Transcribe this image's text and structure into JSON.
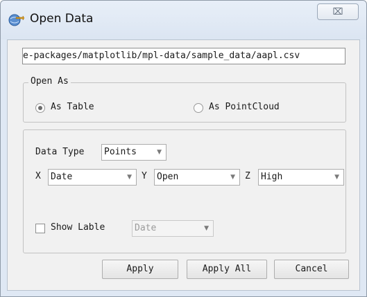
{
  "window": {
    "title": "Open Data",
    "close_glyph": "⌧"
  },
  "path": {
    "value": "site-packages/matplotlib/mpl-data/sample_data/aapl.csv",
    "visible": "e-packages/matplotlib/mpl-data/sample_data/aapl.csv"
  },
  "open_as": {
    "legend": "Open As",
    "options": [
      {
        "label": "As Table",
        "checked": true
      },
      {
        "label": "As PointCloud",
        "checked": false
      }
    ]
  },
  "data_settings": {
    "data_type_label": "Data Type",
    "data_type_value": "Points",
    "x_label": "X",
    "x_value": "Date",
    "y_label": "Y",
    "y_value": "Open",
    "z_label": "Z",
    "z_value": "High",
    "show_label_text": "Show Lable",
    "show_label_checked": false,
    "show_label_value": "Date"
  },
  "buttons": {
    "apply": "Apply",
    "apply_all": "Apply All",
    "cancel": "Cancel"
  },
  "icons": {
    "arrow": "▼",
    "app": "globe-arrow-icon"
  }
}
